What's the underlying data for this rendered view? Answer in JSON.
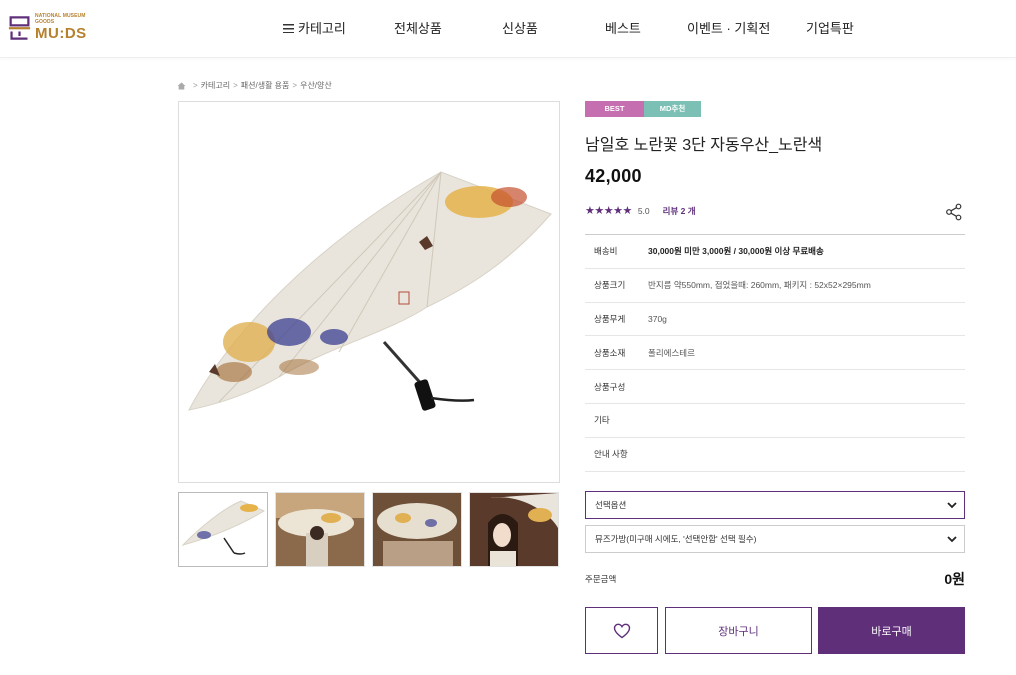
{
  "brand": {
    "small_text": "NATIONAL MUSEUM GOODS",
    "logo_text": "MU:DS",
    "accent_color": "#b6812d"
  },
  "nav": {
    "category": "카테고리",
    "all_products": "전체상품",
    "new_products": "신상품",
    "best": "베스트",
    "events": "이벤트 · 기획전",
    "corporate": "기업특판"
  },
  "breadcrumb": {
    "home_icon": "home-icon",
    "items": [
      "카테고리",
      "패션/생활 용품",
      "우산/양산"
    ]
  },
  "product": {
    "badges": [
      "BEST",
      "MD추천"
    ],
    "title": "남일호 노란꽃 3단 자동우산_노란색",
    "price": "42,000",
    "rating_stars": "★★★★★",
    "rating_score": "5.0",
    "review_link": "리뷰 2 개",
    "specs": [
      {
        "label": "배송비",
        "value": "30,000원 미만 3,000원 / 30,000원 이상 무료배송"
      },
      {
        "label": "상품크기",
        "value": "반지름 약550mm, 접었을때: 260mm, 패키지 : 52x52×295mm"
      },
      {
        "label": "상품무게",
        "value": "370g"
      },
      {
        "label": "상품소재",
        "value": "폴리에스테르"
      },
      {
        "label": "상품구성",
        "value": ""
      },
      {
        "label": "기타",
        "value": ""
      },
      {
        "label": "안내 사항",
        "value": ""
      }
    ],
    "option_select": "선택옵션",
    "bag_select": "뮤즈가방(미구매 시에도, '선택안함' 선택 필수)",
    "order_label": "주문금액",
    "order_amount": "0원",
    "cart_button": "장바구니",
    "buy_button": "바로구매",
    "primary_color": "#5f2f7a"
  }
}
